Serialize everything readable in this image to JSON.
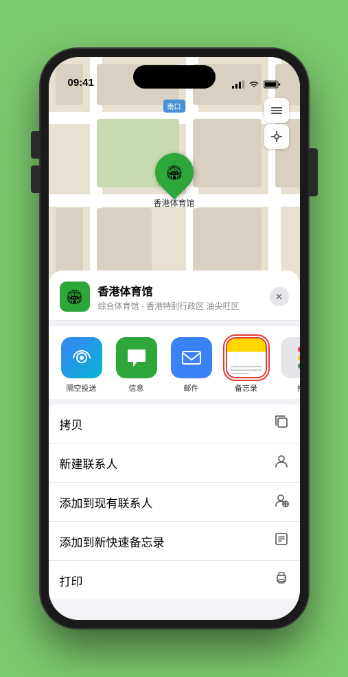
{
  "status_bar": {
    "time": "09:41",
    "location_arrow": "▶"
  },
  "map": {
    "north_label": "南口"
  },
  "venue": {
    "name": "香港体育馆",
    "description": "综合体育馆 · 香港特别行政区 油尖旺区",
    "pin_label": "香港体育馆"
  },
  "share_items": [
    {
      "id": "airdrop",
      "label": "隔空投送",
      "selected": false
    },
    {
      "id": "messages",
      "label": "信息",
      "selected": false
    },
    {
      "id": "mail",
      "label": "邮件",
      "selected": false
    },
    {
      "id": "notes",
      "label": "备忘录",
      "selected": true
    },
    {
      "id": "more",
      "label": "推",
      "selected": false
    }
  ],
  "actions": [
    {
      "label": "拷贝",
      "icon": "📋"
    },
    {
      "label": "新建联系人",
      "icon": "👤"
    },
    {
      "label": "添加到现有联系人",
      "icon": "👤"
    },
    {
      "label": "添加到新快速备忘录",
      "icon": "📝"
    },
    {
      "label": "打印",
      "icon": "🖨"
    }
  ]
}
